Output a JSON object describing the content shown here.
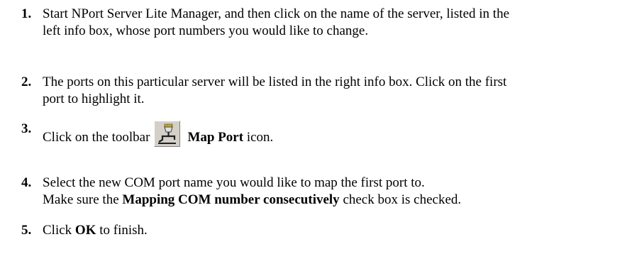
{
  "steps": [
    {
      "number": "1.",
      "lines": [
        "Start NPort Server Lite Manager, and then click on the name of the server, listed in the",
        "left info box, whose port numbers you would like to change."
      ]
    },
    {
      "number": "2.",
      "lines": [
        "The ports on this particular server will be listed in the right info box. Click on the first",
        "port to highlight it."
      ]
    },
    {
      "number": "3.",
      "before_icon": "Click on the toolbar",
      "bold": "Map Port",
      "after_bold": " icon.",
      "icon": "map-port-icon"
    },
    {
      "number": "4.",
      "line1": "Select the new COM port name you would like to map the first port to.",
      "line2_before": "Make sure the ",
      "line2_bold": "Mapping COM number consecutively",
      "line2_after": " check box is checked."
    },
    {
      "number": "5.",
      "before_bold": "Click ",
      "bold": "OK",
      "after_bold": " to finish."
    }
  ]
}
